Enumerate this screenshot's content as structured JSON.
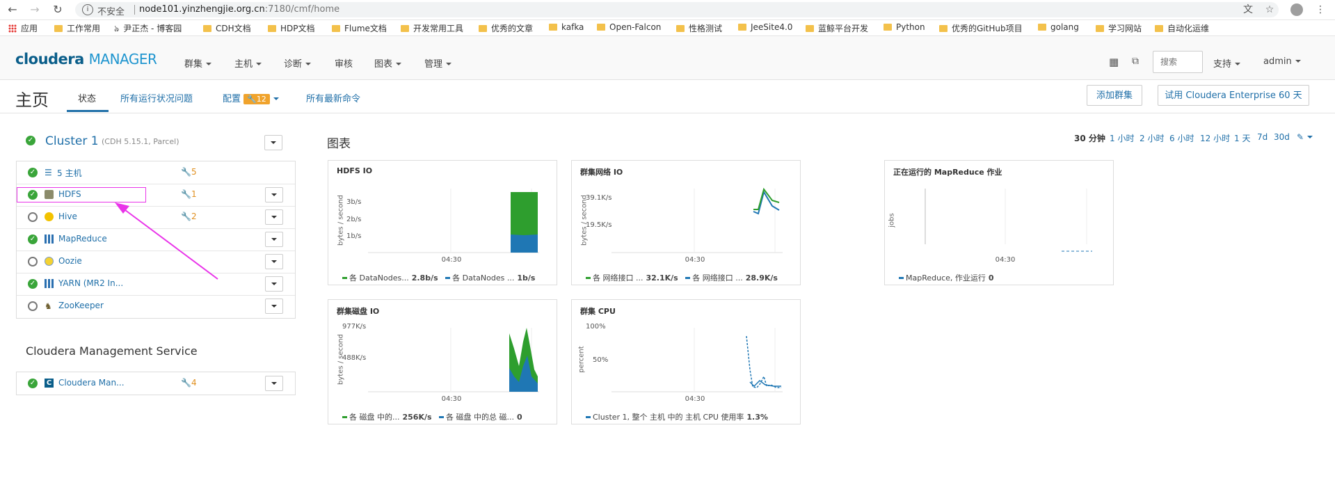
{
  "browser": {
    "insecure_label": "不安全",
    "url_host": "node101.yinzhengjie.org.cn",
    "url_rest": ":7180/cmf/home",
    "bookmarks": [
      "应用",
      "工作常用",
      "尹正杰 - 博客园",
      "CDH文档",
      "HDP文档",
      "Flume文档",
      "开发常用工具",
      "优秀的文章",
      "kafka",
      "Open-Falcon",
      "性格测试",
      "JeeSite4.0",
      "蓝鲸平台开发",
      "Python",
      "优秀的GitHub项目",
      "golang",
      "学习网站",
      "自动化运维"
    ]
  },
  "header": {
    "logo_brand": "cloudera",
    "logo_product": "MANAGER",
    "nav": [
      "群集",
      "主机",
      "诊断",
      "审核",
      "图表",
      "管理"
    ],
    "search_placeholder": "搜索",
    "support": "支持",
    "user": "admin"
  },
  "page": {
    "title": "主页",
    "tabs": [
      "状态",
      "所有运行状况问题",
      "配置",
      "所有最新命令"
    ],
    "config_count": "12",
    "add_cluster": "添加群集",
    "trial": "试用 Cloudera Enterprise 60 天"
  },
  "cluster": {
    "name": "Cluster 1",
    "version": "(CDH 5.15.1, Parcel)",
    "services": [
      {
        "name": "5 主机",
        "status": "ok",
        "issues": "5"
      },
      {
        "name": "HDFS",
        "status": "ok",
        "issues": "1"
      },
      {
        "name": "Hive",
        "status": "stopped",
        "issues": "2"
      },
      {
        "name": "MapReduce",
        "status": "ok",
        "issues": ""
      },
      {
        "name": "Oozie",
        "status": "stopped",
        "issues": ""
      },
      {
        "name": "YARN (MR2 In...",
        "status": "ok",
        "issues": ""
      },
      {
        "name": "ZooKeeper",
        "status": "stopped",
        "issues": ""
      }
    ]
  },
  "mgmt": {
    "title": "Cloudera Management Service",
    "service": "Cloudera Man...",
    "issues": "4"
  },
  "charts_section": {
    "title": "图表",
    "time_ranges": [
      "30 分钟",
      "1 小时",
      "2 小时",
      "6 小时",
      "12 小时",
      "1 天",
      "7d",
      "30d"
    ]
  },
  "chart_data": [
    {
      "type": "area",
      "title": "HDFS IO",
      "ylabel": "bytes / second",
      "yticks": [
        "3b/s",
        "2b/s",
        "1b/s"
      ],
      "xticks": [
        "04:30"
      ],
      "series": [
        {
          "name": "各 DataNodes...",
          "value": "2.8b/s",
          "color": "#2e9e2e"
        },
        {
          "name": "各 DataNodes ...",
          "value": "1b/s",
          "color": "#1f77b4"
        }
      ]
    },
    {
      "type": "line",
      "title": "群集网络 IO",
      "ylabel": "bytes / second",
      "yticks": [
        "39.1K/s",
        "19.5K/s"
      ],
      "xticks": [
        "04:30"
      ],
      "series": [
        {
          "name": "各 网络接口 ...",
          "value": "32.1K/s",
          "color": "#2e9e2e"
        },
        {
          "name": "各 网络接口 ...",
          "value": "28.9K/s",
          "color": "#1f77b4"
        }
      ]
    },
    {
      "type": "line",
      "title": "正在运行的 MapReduce 作业",
      "ylabel": "jobs",
      "yticks": [],
      "xticks": [
        "04:30"
      ],
      "series": [
        {
          "name": "MapReduce, 作业运行",
          "value": "0",
          "color": "#1f77b4"
        }
      ]
    },
    {
      "type": "area",
      "title": "群集磁盘 IO",
      "ylabel": "bytes / second",
      "yticks": [
        "977K/s",
        "488K/s"
      ],
      "xticks": [
        "04:30"
      ],
      "series": [
        {
          "name": "各 磁盘 中的...",
          "value": "256K/s",
          "color": "#2e9e2e"
        },
        {
          "name": "各 磁盘 中的总 磁...",
          "value": "0",
          "color": "#1f77b4"
        }
      ]
    },
    {
      "type": "line",
      "title": "群集 CPU",
      "ylabel": "percent",
      "yticks": [
        "100%",
        "50%"
      ],
      "xticks": [
        "04:30"
      ],
      "series": [
        {
          "name": "Cluster 1, 整个 主机 中的 主机 CPU 使用率",
          "value": "1.3%",
          "color": "#1f77b4"
        }
      ]
    }
  ]
}
